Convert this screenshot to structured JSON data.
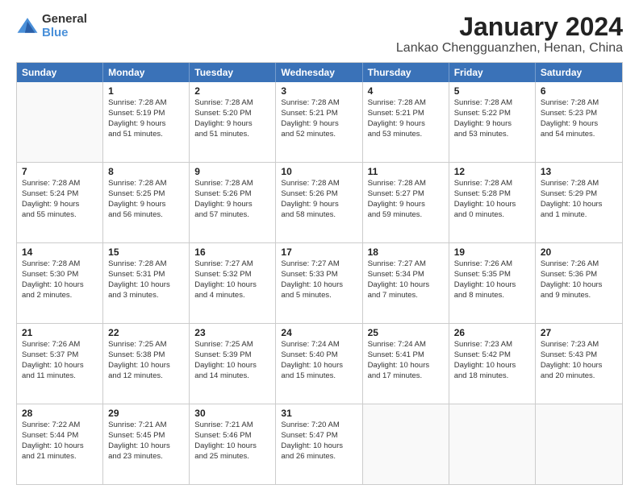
{
  "logo": {
    "general": "General",
    "blue": "Blue"
  },
  "title": "January 2024",
  "subtitle": "Lankao Chengguanzhen, Henan, China",
  "days": [
    "Sunday",
    "Monday",
    "Tuesday",
    "Wednesday",
    "Thursday",
    "Friday",
    "Saturday"
  ],
  "weeks": [
    [
      {
        "day": "",
        "content": ""
      },
      {
        "day": "1",
        "content": "Sunrise: 7:28 AM\nSunset: 5:19 PM\nDaylight: 9 hours\nand 51 minutes."
      },
      {
        "day": "2",
        "content": "Sunrise: 7:28 AM\nSunset: 5:20 PM\nDaylight: 9 hours\nand 51 minutes."
      },
      {
        "day": "3",
        "content": "Sunrise: 7:28 AM\nSunset: 5:21 PM\nDaylight: 9 hours\nand 52 minutes."
      },
      {
        "day": "4",
        "content": "Sunrise: 7:28 AM\nSunset: 5:21 PM\nDaylight: 9 hours\nand 53 minutes."
      },
      {
        "day": "5",
        "content": "Sunrise: 7:28 AM\nSunset: 5:22 PM\nDaylight: 9 hours\nand 53 minutes."
      },
      {
        "day": "6",
        "content": "Sunrise: 7:28 AM\nSunset: 5:23 PM\nDaylight: 9 hours\nand 54 minutes."
      }
    ],
    [
      {
        "day": "7",
        "content": "Sunrise: 7:28 AM\nSunset: 5:24 PM\nDaylight: 9 hours\nand 55 minutes."
      },
      {
        "day": "8",
        "content": "Sunrise: 7:28 AM\nSunset: 5:25 PM\nDaylight: 9 hours\nand 56 minutes."
      },
      {
        "day": "9",
        "content": "Sunrise: 7:28 AM\nSunset: 5:26 PM\nDaylight: 9 hours\nand 57 minutes."
      },
      {
        "day": "10",
        "content": "Sunrise: 7:28 AM\nSunset: 5:26 PM\nDaylight: 9 hours\nand 58 minutes."
      },
      {
        "day": "11",
        "content": "Sunrise: 7:28 AM\nSunset: 5:27 PM\nDaylight: 9 hours\nand 59 minutes."
      },
      {
        "day": "12",
        "content": "Sunrise: 7:28 AM\nSunset: 5:28 PM\nDaylight: 10 hours\nand 0 minutes."
      },
      {
        "day": "13",
        "content": "Sunrise: 7:28 AM\nSunset: 5:29 PM\nDaylight: 10 hours\nand 1 minute."
      }
    ],
    [
      {
        "day": "14",
        "content": "Sunrise: 7:28 AM\nSunset: 5:30 PM\nDaylight: 10 hours\nand 2 minutes."
      },
      {
        "day": "15",
        "content": "Sunrise: 7:28 AM\nSunset: 5:31 PM\nDaylight: 10 hours\nand 3 minutes."
      },
      {
        "day": "16",
        "content": "Sunrise: 7:27 AM\nSunset: 5:32 PM\nDaylight: 10 hours\nand 4 minutes."
      },
      {
        "day": "17",
        "content": "Sunrise: 7:27 AM\nSunset: 5:33 PM\nDaylight: 10 hours\nand 5 minutes."
      },
      {
        "day": "18",
        "content": "Sunrise: 7:27 AM\nSunset: 5:34 PM\nDaylight: 10 hours\nand 7 minutes."
      },
      {
        "day": "19",
        "content": "Sunrise: 7:26 AM\nSunset: 5:35 PM\nDaylight: 10 hours\nand 8 minutes."
      },
      {
        "day": "20",
        "content": "Sunrise: 7:26 AM\nSunset: 5:36 PM\nDaylight: 10 hours\nand 9 minutes."
      }
    ],
    [
      {
        "day": "21",
        "content": "Sunrise: 7:26 AM\nSunset: 5:37 PM\nDaylight: 10 hours\nand 11 minutes."
      },
      {
        "day": "22",
        "content": "Sunrise: 7:25 AM\nSunset: 5:38 PM\nDaylight: 10 hours\nand 12 minutes."
      },
      {
        "day": "23",
        "content": "Sunrise: 7:25 AM\nSunset: 5:39 PM\nDaylight: 10 hours\nand 14 minutes."
      },
      {
        "day": "24",
        "content": "Sunrise: 7:24 AM\nSunset: 5:40 PM\nDaylight: 10 hours\nand 15 minutes."
      },
      {
        "day": "25",
        "content": "Sunrise: 7:24 AM\nSunset: 5:41 PM\nDaylight: 10 hours\nand 17 minutes."
      },
      {
        "day": "26",
        "content": "Sunrise: 7:23 AM\nSunset: 5:42 PM\nDaylight: 10 hours\nand 18 minutes."
      },
      {
        "day": "27",
        "content": "Sunrise: 7:23 AM\nSunset: 5:43 PM\nDaylight: 10 hours\nand 20 minutes."
      }
    ],
    [
      {
        "day": "28",
        "content": "Sunrise: 7:22 AM\nSunset: 5:44 PM\nDaylight: 10 hours\nand 21 minutes."
      },
      {
        "day": "29",
        "content": "Sunrise: 7:21 AM\nSunset: 5:45 PM\nDaylight: 10 hours\nand 23 minutes."
      },
      {
        "day": "30",
        "content": "Sunrise: 7:21 AM\nSunset: 5:46 PM\nDaylight: 10 hours\nand 25 minutes."
      },
      {
        "day": "31",
        "content": "Sunrise: 7:20 AM\nSunset: 5:47 PM\nDaylight: 10 hours\nand 26 minutes."
      },
      {
        "day": "",
        "content": ""
      },
      {
        "day": "",
        "content": ""
      },
      {
        "day": "",
        "content": ""
      }
    ]
  ]
}
